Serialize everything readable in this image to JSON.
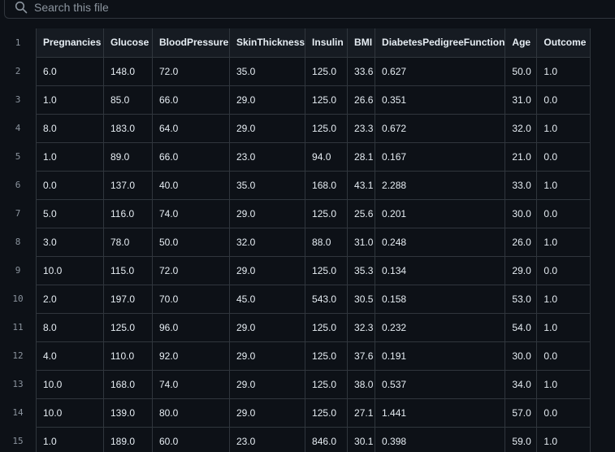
{
  "search": {
    "placeholder": "Search this file",
    "icon": "search-icon"
  },
  "table": {
    "line_numbers": [
      "1",
      "2",
      "3",
      "4",
      "5",
      "6",
      "7",
      "8",
      "9",
      "10",
      "11",
      "12",
      "13",
      "14",
      "15"
    ],
    "headers": [
      "Pregnancies",
      "Glucose",
      "BloodPressure",
      "SkinThickness",
      "Insulin",
      "BMI",
      "DiabetesPedigreeFunction",
      "Age",
      "Outcome"
    ],
    "rows": [
      [
        "6.0",
        "148.0",
        "72.0",
        "35.0",
        "125.0",
        "33.6",
        "0.627",
        "50.0",
        "1.0"
      ],
      [
        "1.0",
        "85.0",
        "66.0",
        "29.0",
        "125.0",
        "26.6",
        "0.351",
        "31.0",
        "0.0"
      ],
      [
        "8.0",
        "183.0",
        "64.0",
        "29.0",
        "125.0",
        "23.3",
        "0.672",
        "32.0",
        "1.0"
      ],
      [
        "1.0",
        "89.0",
        "66.0",
        "23.0",
        "94.0",
        "28.1",
        "0.167",
        "21.0",
        "0.0"
      ],
      [
        "0.0",
        "137.0",
        "40.0",
        "35.0",
        "168.0",
        "43.1",
        "2.288",
        "33.0",
        "1.0"
      ],
      [
        "5.0",
        "116.0",
        "74.0",
        "29.0",
        "125.0",
        "25.6",
        "0.201",
        "30.0",
        "0.0"
      ],
      [
        "3.0",
        "78.0",
        "50.0",
        "32.0",
        "88.0",
        "31.0",
        "0.248",
        "26.0",
        "1.0"
      ],
      [
        "10.0",
        "115.0",
        "72.0",
        "29.0",
        "125.0",
        "35.3",
        "0.134",
        "29.0",
        "0.0"
      ],
      [
        "2.0",
        "197.0",
        "70.0",
        "45.0",
        "543.0",
        "30.5",
        "0.158",
        "53.0",
        "1.0"
      ],
      [
        "8.0",
        "125.0",
        "96.0",
        "29.0",
        "125.0",
        "32.3",
        "0.232",
        "54.0",
        "1.0"
      ],
      [
        "4.0",
        "110.0",
        "92.0",
        "29.0",
        "125.0",
        "37.6",
        "0.191",
        "30.0",
        "0.0"
      ],
      [
        "10.0",
        "168.0",
        "74.0",
        "29.0",
        "125.0",
        "38.0",
        "0.537",
        "34.0",
        "1.0"
      ],
      [
        "10.0",
        "139.0",
        "80.0",
        "29.0",
        "125.0",
        "27.1",
        "1.441",
        "57.0",
        "0.0"
      ],
      [
        "1.0",
        "189.0",
        "60.0",
        "23.0",
        "846.0",
        "30.1",
        "0.398",
        "59.0",
        "1.0"
      ]
    ]
  }
}
